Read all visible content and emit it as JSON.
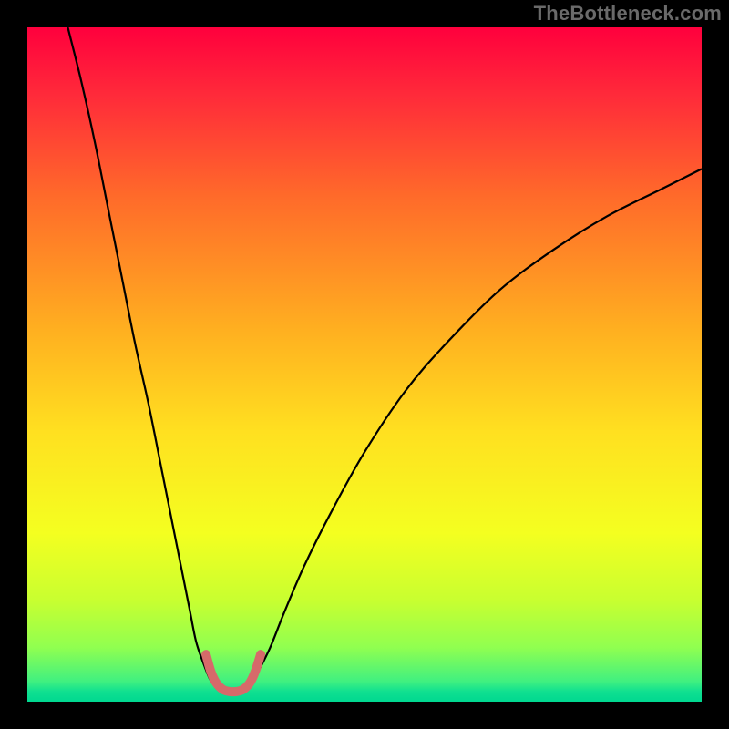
{
  "watermark": "TheBottleneck.com",
  "chart_data": {
    "type": "line",
    "title": "",
    "xlabel": "",
    "ylabel": "",
    "xlim": [
      0,
      100
    ],
    "ylim": [
      0,
      100
    ],
    "grid": false,
    "legend": false,
    "gradient_stops": [
      {
        "pos": 0.0,
        "color": "#ff003d"
      },
      {
        "pos": 0.1,
        "color": "#ff2a3a"
      },
      {
        "pos": 0.25,
        "color": "#ff6a2a"
      },
      {
        "pos": 0.45,
        "color": "#ffb020"
      },
      {
        "pos": 0.6,
        "color": "#ffe020"
      },
      {
        "pos": 0.75,
        "color": "#f4ff20"
      },
      {
        "pos": 0.85,
        "color": "#c8ff30"
      },
      {
        "pos": 0.92,
        "color": "#90ff50"
      },
      {
        "pos": 0.97,
        "color": "#40f080"
      },
      {
        "pos": 0.985,
        "color": "#10e090"
      },
      {
        "pos": 1.0,
        "color": "#00d890"
      }
    ],
    "series": [
      {
        "name": "left-branch",
        "stroke": "#000000",
        "stroke_width": 2.2,
        "x": [
          6,
          8,
          10,
          12,
          14,
          16,
          18,
          20,
          22,
          24,
          25,
          26,
          27,
          28
        ],
        "y": [
          100,
          92,
          83,
          73,
          63,
          53,
          44,
          34,
          24,
          14,
          9,
          6,
          3.5,
          2
        ]
      },
      {
        "name": "right-branch",
        "stroke": "#000000",
        "stroke_width": 2.2,
        "x": [
          33,
          34,
          36,
          38,
          41,
          45,
          50,
          56,
          62,
          70,
          78,
          86,
          94,
          100
        ],
        "y": [
          2,
          4,
          8,
          13,
          20,
          28,
          37,
          46,
          53,
          61,
          67,
          72,
          76,
          79
        ]
      },
      {
        "name": "trough-marker",
        "stroke": "#d66a6a",
        "stroke_width": 10,
        "linecap": "round",
        "x": [
          26.5,
          27.2,
          28.0,
          29.0,
          30.0,
          31.0,
          32.0,
          33.0,
          33.8,
          34.6
        ],
        "y": [
          7.0,
          4.5,
          2.8,
          1.8,
          1.5,
          1.5,
          1.8,
          2.8,
          4.5,
          7.0
        ]
      }
    ]
  }
}
